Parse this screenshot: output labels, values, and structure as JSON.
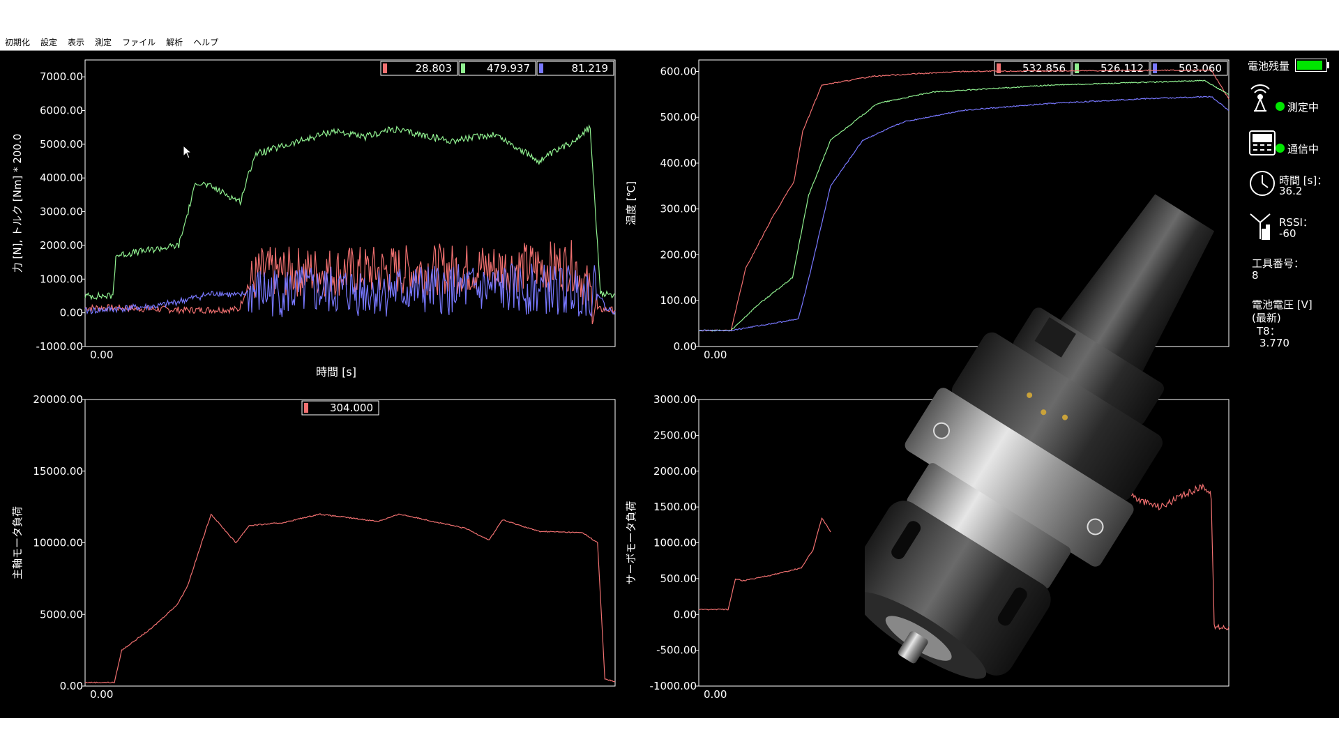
{
  "menu": [
    "初期化",
    "設定",
    "表示",
    "測定",
    "ファイル",
    "解析",
    "ヘルプ"
  ],
  "colors": {
    "red": "#f07070",
    "green": "#90f090",
    "blue": "#7878ff",
    "axis": "#ffffff",
    "background": "#000000",
    "ok": "#00e600"
  },
  "status": {
    "battery_label": "電池残量",
    "battery_level": 0.9,
    "measuring": "測定中",
    "communicating": "通信中",
    "time_label": "時間 [s]：",
    "time_value": "36.2",
    "rssi_label": "RSSI：",
    "rssi_value": "-60",
    "tool_no_label": "工具番号：",
    "tool_no_value": "8",
    "voltage_label": "電池電圧 [V]",
    "voltage_sub": "(最新)",
    "voltage_channel": "T8：",
    "voltage_value": "3.770"
  },
  "icons": {
    "antenna": "antenna-icon",
    "device": "device-icon",
    "clock": "clock-icon",
    "signal": "signal-icon",
    "tool_holder": "tool-holder-image",
    "cursor": "mouse-cursor-icon"
  },
  "chart_data": [
    {
      "type": "line",
      "ylabel": "力 [N], トルク [Nm] * 200.0",
      "xlabel": "時間 [s]",
      "ylim": [
        -1000,
        7500
      ],
      "yticks": [
        "-1000.00",
        "0.00",
        "1000.00",
        "2000.00",
        "3000.00",
        "4000.00",
        "5000.00",
        "6000.00",
        "7000.00"
      ],
      "x_tick": "0.00",
      "x_range": [
        0,
        36.2
      ],
      "legend_values": [
        "28.803",
        "479.937",
        "81.219"
      ],
      "series": [
        {
          "color": "red",
          "noisy": true,
          "x": [
            0,
            1.9,
            7,
            10.5,
            11.1,
            12,
            20,
            25,
            33.5,
            35,
            36.2
          ],
          "y": [
            150,
            150,
            80,
            100,
            800,
            1200,
            1250,
            1300,
            1400,
            100,
            80
          ]
        },
        {
          "color": "green",
          "noisy": true,
          "x": [
            0,
            1.9,
            2.1,
            6.4,
            7.6,
            8.8,
            10.6,
            11.6,
            14,
            17,
            19,
            21,
            25,
            28,
            31,
            33,
            34.5,
            35.2,
            36.2
          ],
          "y": [
            500,
            500,
            1700,
            2000,
            3900,
            3700,
            3300,
            4700,
            5000,
            5400,
            5200,
            5450,
            5100,
            5300,
            4500,
            5000,
            5500,
            550,
            550
          ]
        },
        {
          "color": "blue",
          "noisy": true,
          "x": [
            0,
            5,
            9,
            10.5,
            11.1,
            20,
            30,
            35,
            35.6,
            36.2
          ],
          "y": [
            50,
            200,
            600,
            500,
            600,
            650,
            700,
            650,
            100,
            50
          ]
        }
      ]
    },
    {
      "type": "line",
      "ylabel": "温度 [℃]",
      "xlabel": "",
      "ylim": [
        0,
        625
      ],
      "yticks": [
        "0.00",
        "100.00",
        "200.00",
        "300.00",
        "400.00",
        "500.00",
        "600.00"
      ],
      "x_tick": "0.00",
      "x_range": [
        0,
        36.2
      ],
      "legend_values": [
        "532.856",
        "526.112",
        "503.060"
      ],
      "series": [
        {
          "color": "red",
          "noisy": false,
          "x": [
            0,
            2.2,
            3.2,
            5,
            6.5,
            7.1,
            8.4,
            12,
            18,
            35,
            36.2
          ],
          "y": [
            35,
            35,
            170,
            280,
            360,
            470,
            570,
            590,
            600,
            603,
            540
          ]
        },
        {
          "color": "green",
          "noisy": false,
          "x": [
            0,
            2.2,
            4,
            6.4,
            7.5,
            9,
            11,
            12.2,
            16,
            24,
            34.5,
            36.2
          ],
          "y": [
            35,
            35,
            90,
            150,
            330,
            450,
            500,
            530,
            555,
            570,
            580,
            550
          ]
        },
        {
          "color": "blue",
          "noisy": false,
          "x": [
            0,
            2.2,
            6.8,
            7.6,
            9,
            11.2,
            14,
            18,
            24,
            30,
            35,
            36.2
          ],
          "y": [
            35,
            35,
            60,
            160,
            350,
            450,
            490,
            515,
            530,
            540,
            545,
            515
          ]
        }
      ]
    },
    {
      "type": "line",
      "ylabel": "主軸モータ負荷",
      "xlabel": "",
      "ylim": [
        0,
        20000
      ],
      "yticks": [
        "0.00",
        "5000.00",
        "10000.00",
        "15000.00",
        "20000.00"
      ],
      "x_tick": "0.00",
      "x_range": [
        0,
        36.2
      ],
      "legend_values": [
        "304.000"
      ],
      "series": [
        {
          "color": "red",
          "noisy": false,
          "x": [
            0,
            2,
            2.5,
            4.5,
            6.3,
            7,
            8.6,
            10.3,
            11.2,
            13.5,
            16,
            20,
            21.5,
            26,
            27.6,
            28.5,
            31,
            34,
            35,
            35.5,
            36.2
          ],
          "y": [
            250,
            250,
            2500,
            4000,
            5700,
            7000,
            12000,
            10000,
            11200,
            11400,
            12000,
            11500,
            12000,
            11000,
            10200,
            11600,
            10800,
            10700,
            10000,
            500,
            300
          ]
        }
      ]
    },
    {
      "type": "line",
      "ylabel": "サーボモータ負荷",
      "xlabel": "",
      "ylim": [
        -1000,
        3000
      ],
      "yticks": [
        "-1000.00",
        "-500.00",
        "0.00",
        "500.00",
        "1000.00",
        "1500.00",
        "2000.00",
        "2500.00",
        "3000.00"
      ],
      "x_tick": "0.00",
      "x_range": [
        0,
        36.2
      ],
      "legend_values": [],
      "series": [
        {
          "color": "red",
          "noisy": false,
          "x": [
            0,
            2,
            2.5,
            3,
            5,
            7,
            7.8,
            8.4,
            9
          ],
          "y": [
            70,
            70,
            500,
            470,
            550,
            650,
            900,
            1350,
            1150
          ]
        },
        {
          "color": "red",
          "noisy": true,
          "x": [
            29,
            30,
            31.5,
            33,
            34.5,
            35,
            35.2,
            36.2
          ],
          "y": [
            1800,
            1600,
            1500,
            1650,
            1800,
            1650,
            -170,
            -170
          ]
        }
      ]
    }
  ]
}
